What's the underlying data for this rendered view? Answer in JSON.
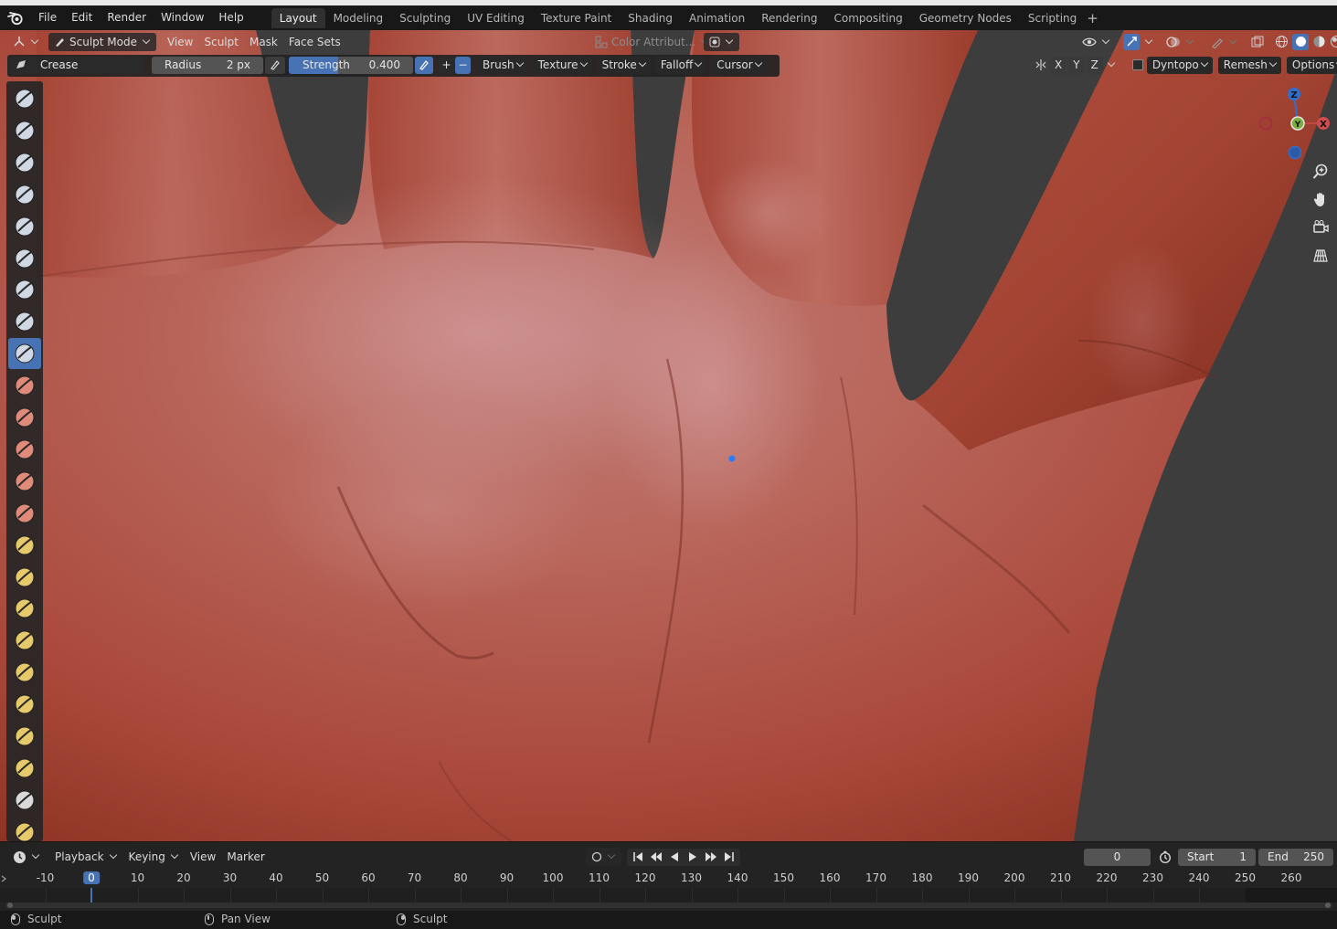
{
  "menus": [
    "File",
    "Edit",
    "Render",
    "Window",
    "Help"
  ],
  "workspaces": [
    "Layout",
    "Modeling",
    "Sculpting",
    "UV Editing",
    "Texture Paint",
    "Shading",
    "Animation",
    "Rendering",
    "Compositing",
    "Geometry Nodes",
    "Scripting"
  ],
  "active_workspace": "Layout",
  "viewport_header": {
    "mode": "Sculpt Mode",
    "menus": [
      "View",
      "Sculpt",
      "Mask",
      "Face Sets"
    ],
    "color_attribute": "Color Attribut..."
  },
  "tool_header": {
    "brush_name": "Crease",
    "radius_label": "Radius",
    "radius_value": "2 px",
    "strength_label": "Strength",
    "strength_value": "0.400",
    "strength_fraction": 0.4,
    "plus": "+",
    "minus": "−",
    "dropdowns": [
      "Brush",
      "Texture",
      "Stroke",
      "Falloff",
      "Cursor"
    ],
    "symmetry_axes": [
      "X",
      "Y",
      "Z"
    ],
    "dyntopo": "Dyntopo",
    "remesh": "Remesh",
    "options": "Options"
  },
  "toolbar": {
    "active_index": 8,
    "tools": [
      {
        "name": "draw-tool",
        "color": "#cfd8e3"
      },
      {
        "name": "draw-sharp-tool",
        "color": "#cfd8e3"
      },
      {
        "name": "clay-tool",
        "color": "#cfd8e3"
      },
      {
        "name": "clay-strips-tool",
        "color": "#cfd8e3"
      },
      {
        "name": "clay-thumb-tool",
        "color": "#cfd8e3"
      },
      {
        "name": "layer-tool",
        "color": "#cfd8e3"
      },
      {
        "name": "inflate-tool",
        "color": "#cfd8e3"
      },
      {
        "name": "blob-tool",
        "color": "#cfd8e3"
      },
      {
        "name": "crease-tool",
        "color": "#cfd8e3"
      },
      {
        "name": "smooth-tool",
        "color": "#e08a7a"
      },
      {
        "name": "flatten-tool",
        "color": "#e08a7a"
      },
      {
        "name": "fill-tool",
        "color": "#e08a7a"
      },
      {
        "name": "scrape-tool",
        "color": "#e08a7a"
      },
      {
        "name": "multiplane-scrape-tool",
        "color": "#e08a7a"
      },
      {
        "name": "pinch-tool",
        "color": "#e6c96a"
      },
      {
        "name": "grab-tool",
        "color": "#e6c96a"
      },
      {
        "name": "elastic-deform-tool",
        "color": "#e6c96a"
      },
      {
        "name": "snake-hook-tool",
        "color": "#e6c96a"
      },
      {
        "name": "thumb-tool",
        "color": "#e6c96a"
      },
      {
        "name": "pose-tool",
        "color": "#e6c96a"
      },
      {
        "name": "nudge-tool",
        "color": "#e6c96a"
      },
      {
        "name": "rotate-tool",
        "color": "#e6c96a"
      },
      {
        "name": "slide-relax-tool",
        "color": "#d9d9d9"
      },
      {
        "name": "boundary-tool",
        "color": "#e6c96a"
      }
    ]
  },
  "gizmo": {
    "z": "Z",
    "y": "Y",
    "x": "X"
  },
  "timeline": {
    "menus": [
      "Playback",
      "Keying",
      "View",
      "Marker"
    ],
    "current_frame": "0",
    "start_label": "Start",
    "start_value": "1",
    "end_label": "End",
    "end_value": "250",
    "ruler_labels": [
      "-10",
      "0",
      "10",
      "20",
      "30",
      "40",
      "50",
      "60",
      "70",
      "80",
      "90",
      "100",
      "110",
      "120",
      "130",
      "140",
      "150",
      "160",
      "170",
      "180",
      "190",
      "200",
      "210",
      "220",
      "230",
      "240",
      "250",
      "260"
    ]
  },
  "statusbar": {
    "left": "Sculpt",
    "middle": "Pan View",
    "right": "Sculpt"
  },
  "colors": {
    "accent": "#4772b3",
    "skin": "#b5574a",
    "background": "#3d3d3d"
  }
}
